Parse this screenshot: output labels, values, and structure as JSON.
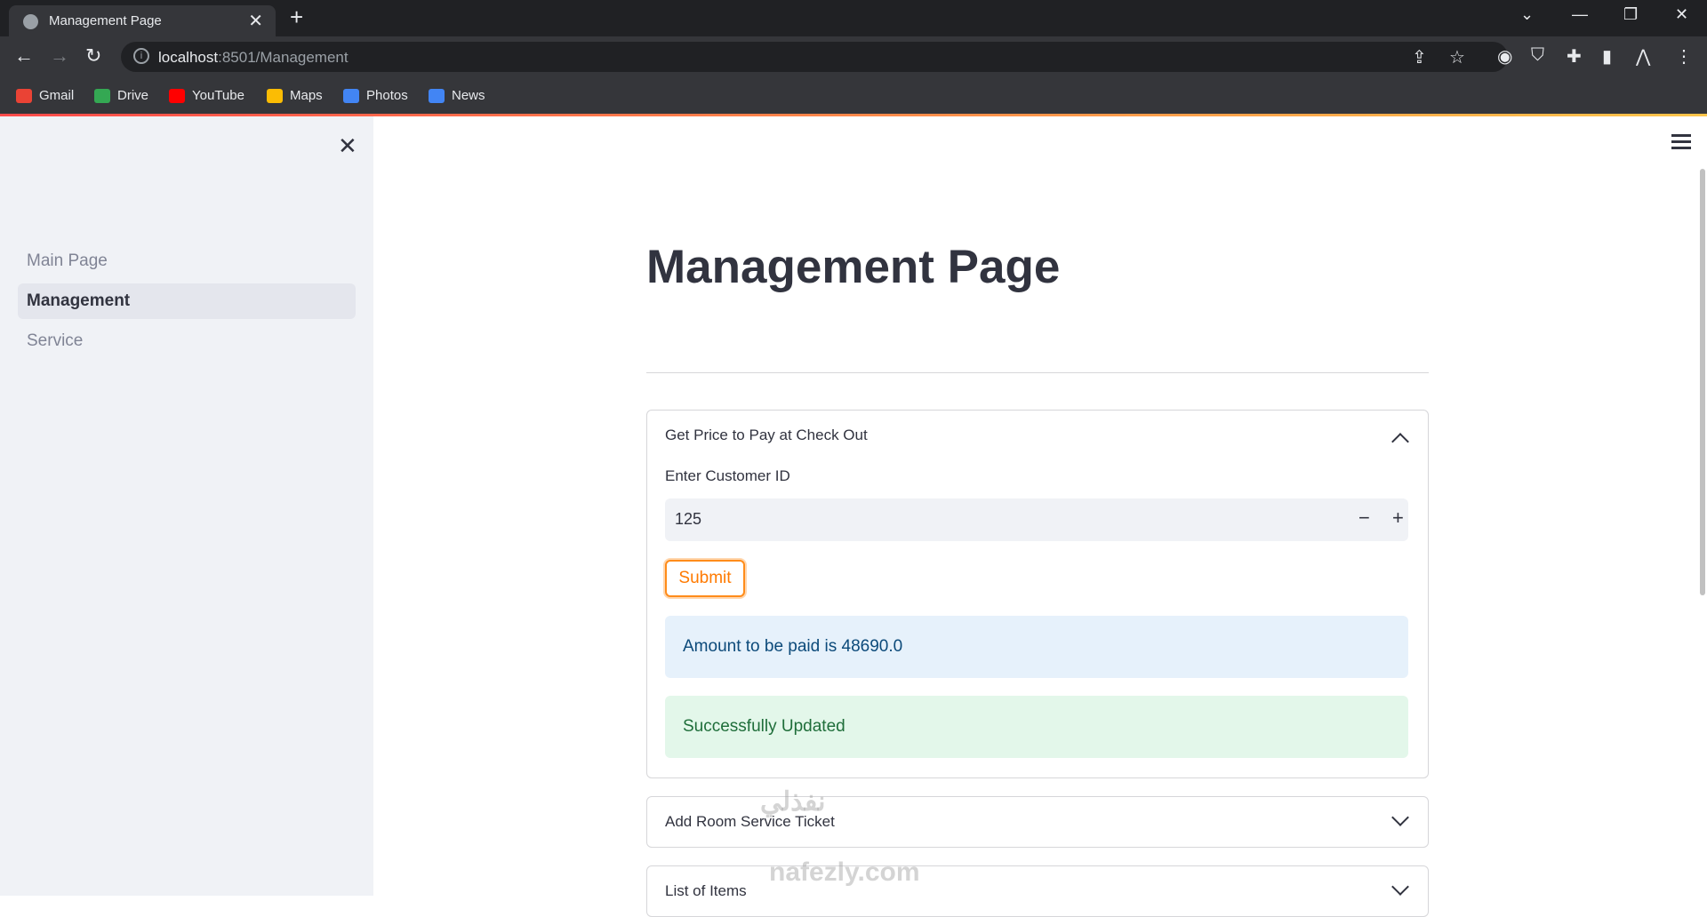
{
  "browser": {
    "tab_title": "Management Page",
    "url_host": "localhost",
    "url_rest": ":8501/Management",
    "bookmarks": [
      "Gmail",
      "Drive",
      "YouTube",
      "Maps",
      "Photos",
      "News"
    ]
  },
  "sidebar": {
    "items": [
      {
        "label": "Main Page"
      },
      {
        "label": "Management"
      },
      {
        "label": "Service"
      }
    ],
    "active_index": 1
  },
  "main": {
    "title": "Management Page",
    "expanders": [
      {
        "header": "Get Price to Pay at Check Out",
        "expanded": true,
        "field_label": "Enter Customer ID",
        "field_value": "125",
        "submit_label": "Submit",
        "info_message": "Amount to be paid is 48690.0",
        "success_message": "Successfully Updated"
      },
      {
        "header": "Add Room Service Ticket",
        "expanded": false
      },
      {
        "header": "List of Items",
        "expanded": false
      }
    ]
  },
  "watermark": {
    "arabic": "نفذلي",
    "latin": "nafezly.com"
  },
  "colors": {
    "accent_orange": "#ff8c1a",
    "info_bg": "#e6f1fb",
    "success_bg": "#e3f7ea",
    "sidebar_bg": "#f0f2f6"
  }
}
